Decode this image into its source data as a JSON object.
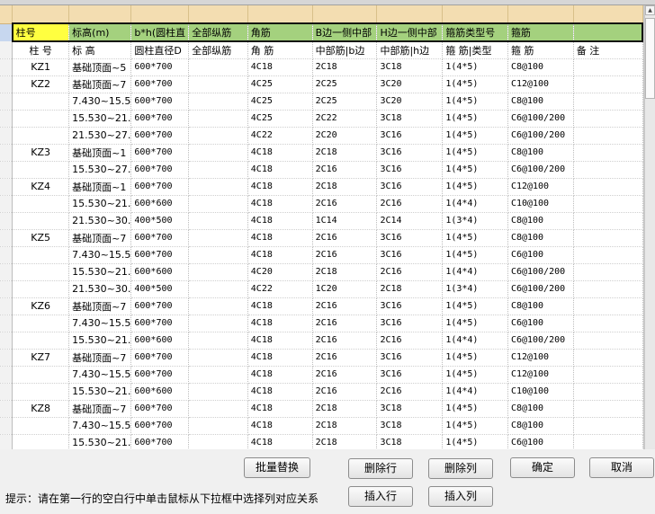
{
  "mapping_header": {
    "labels": [
      "柱号",
      "标高(m)",
      "b*h(圆柱直",
      "全部纵筋",
      "角筋",
      "B边一侧中部",
      "H边一侧中部",
      "箍筋类型号",
      "箍筋",
      ""
    ]
  },
  "column_labels": [
    "柱 号",
    "标   高",
    "圆柱直径D",
    "全部纵筋",
    "角   筋",
    "中部筋|b边",
    "中部筋|h边",
    "箍 筋|类型",
    "箍   筋",
    "备   注"
  ],
  "rows": [
    [
      "KZ1",
      "基础顶面~5",
      "600*700",
      "",
      "4C18",
      "2C18",
      "3C18",
      "1(4*5)",
      "C8@100",
      ""
    ],
    [
      "KZ2",
      "基础顶面~7",
      "600*700",
      "",
      "4C25",
      "2C25",
      "3C20",
      "1(4*5)",
      "C12@100",
      ""
    ],
    [
      "",
      "7.430~15.5",
      "600*700",
      "",
      "4C25",
      "2C25",
      "3C20",
      "1(4*5)",
      "C8@100",
      ""
    ],
    [
      "",
      "15.530~21.",
      "600*700",
      "",
      "4C25",
      "2C22",
      "3C18",
      "1(4*5)",
      "C6@100/200",
      ""
    ],
    [
      "",
      "21.530~27.",
      "600*700",
      "",
      "4C22",
      "2C20",
      "3C16",
      "1(4*5)",
      "C6@100/200",
      ""
    ],
    [
      "KZ3",
      "基础顶面~1",
      "600*700",
      "",
      "4C18",
      "2C18",
      "3C16",
      "1(4*5)",
      "C8@100",
      ""
    ],
    [
      "",
      "15.530~27.",
      "600*700",
      "",
      "4C18",
      "2C16",
      "3C16",
      "1(4*5)",
      "C6@100/200",
      ""
    ],
    [
      "KZ4",
      "基础顶面~1",
      "600*700",
      "",
      "4C18",
      "2C18",
      "3C16",
      "1(4*5)",
      "C12@100",
      ""
    ],
    [
      "",
      "15.530~21.",
      "600*600",
      "",
      "4C18",
      "2C16",
      "2C16",
      "1(4*4)",
      "C10@100",
      ""
    ],
    [
      "",
      "21.530~30.",
      "400*500",
      "",
      "4C18",
      "1C14",
      "2C14",
      "1(3*4)",
      "C8@100",
      ""
    ],
    [
      "KZ5",
      "基础顶面~7",
      "600*700",
      "",
      "4C18",
      "2C16",
      "3C16",
      "1(4*5)",
      "C8@100",
      ""
    ],
    [
      "",
      "7.430~15.5",
      "600*700",
      "",
      "4C18",
      "2C16",
      "3C16",
      "1(4*5)",
      "C6@100",
      ""
    ],
    [
      "",
      "15.530~21.",
      "600*600",
      "",
      "4C20",
      "2C18",
      "2C16",
      "1(4*4)",
      "C6@100/200",
      ""
    ],
    [
      "",
      "21.530~30.",
      "400*500",
      "",
      "4C22",
      "1C20",
      "2C18",
      "1(3*4)",
      "C6@100/200",
      ""
    ],
    [
      "KZ6",
      "基础顶面~7",
      "600*700",
      "",
      "4C18",
      "2C16",
      "3C16",
      "1(4*5)",
      "C8@100",
      ""
    ],
    [
      "",
      "7.430~15.5",
      "600*700",
      "",
      "4C18",
      "2C16",
      "3C16",
      "1(4*5)",
      "C6@100",
      ""
    ],
    [
      "",
      "15.530~21.",
      "600*600",
      "",
      "4C18",
      "2C16",
      "2C16",
      "1(4*4)",
      "C6@100/200",
      ""
    ],
    [
      "KZ7",
      "基础顶面~7",
      "600*700",
      "",
      "4C18",
      "2C16",
      "3C16",
      "1(4*5)",
      "C12@100",
      ""
    ],
    [
      "",
      "7.430~15.5",
      "600*700",
      "",
      "4C18",
      "2C16",
      "3C16",
      "1(4*5)",
      "C12@100",
      ""
    ],
    [
      "",
      "15.530~21.",
      "600*600",
      "",
      "4C18",
      "2C16",
      "2C16",
      "1(4*4)",
      "C10@100",
      ""
    ],
    [
      "KZ8",
      "基础顶面~7",
      "600*700",
      "",
      "4C18",
      "2C18",
      "3C18",
      "1(4*5)",
      "C8@100",
      ""
    ],
    [
      "",
      "7.430~15.5",
      "600*700",
      "",
      "4C18",
      "2C18",
      "3C18",
      "1(4*5)",
      "C8@100",
      ""
    ],
    [
      "",
      "15.530~21.",
      "600*700",
      "",
      "4C18",
      "2C18",
      "3C18",
      "1(4*5)",
      "C6@100",
      ""
    ]
  ],
  "buttons": {
    "batch_replace": "批量替换",
    "delete_row": "删除行",
    "delete_col": "删除列",
    "ok": "确定",
    "cancel": "取消",
    "insert_row": "插入行",
    "insert_col": "插入列"
  },
  "hint": "提示：请在第一行的空白行中单击鼠标从下拉框中选择列对应关系",
  "colors": {
    "header_tan": "#f3ddb1",
    "mapping_green": "#a4d17e",
    "mapping_yellow": "#ffff40"
  }
}
